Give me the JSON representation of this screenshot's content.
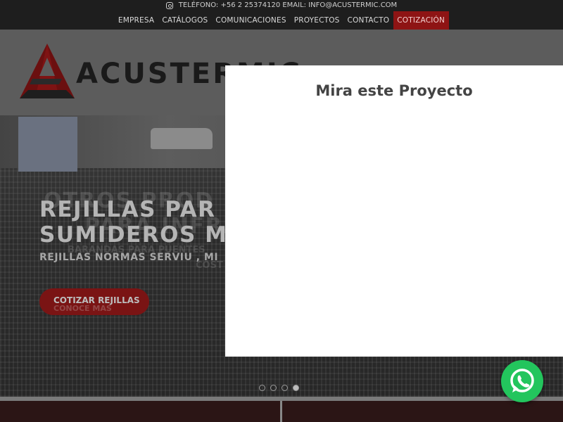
{
  "topbar": {
    "contact_text": "TELÉFONO: +56 2 25374120 EMAIL: INFO@ACUSTERMIC.COM",
    "nav": [
      {
        "label": "EMPRESA"
      },
      {
        "label": "CATÁLOGOS"
      },
      {
        "label": "COMUNICACIONES"
      },
      {
        "label": "PROYECTOS"
      },
      {
        "label": "CONTACTO"
      },
      {
        "label": "COTIZACIÓN",
        "active": true
      }
    ]
  },
  "header": {
    "logo_text": "ACUSTERMIC"
  },
  "hero": {
    "ghost_line1": "OTROS PROD",
    "ghost_line2": "PARA INFRA",
    "ghost_line3": "BARANDAS PARA PUENTES",
    "ghost_line4": "COST",
    "headline_line1": "REJILLAS PAR",
    "headline_line2": "SUMIDEROS M",
    "subheadline": "REJILLAS NORMAS SERVIU , MI",
    "cta_label": "COTIZAR REJILLAS",
    "cta_ghost": "CONOCE MAS",
    "slides_total": 4,
    "active_slide": 4
  },
  "modal": {
    "title": "Mira este Proyecto"
  },
  "colors": {
    "accent": "#8e1414",
    "whatsapp": "#23c55d"
  }
}
